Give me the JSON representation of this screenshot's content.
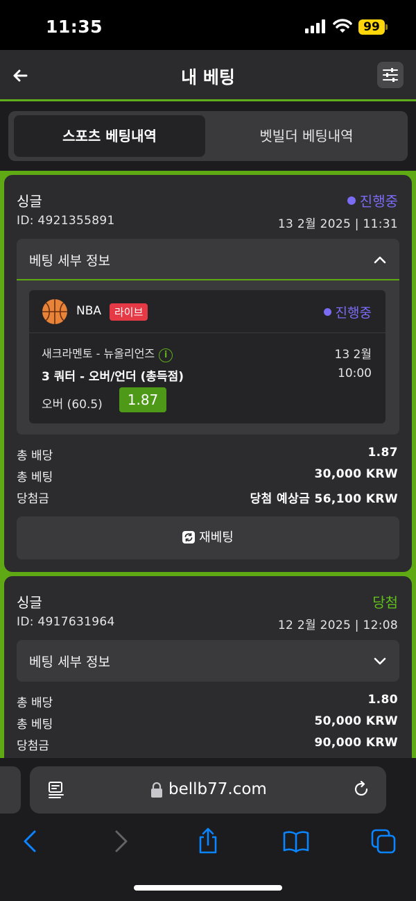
{
  "status_bar": {
    "time": "11:35",
    "battery": "99"
  },
  "header": {
    "title": "내 베팅"
  },
  "tabs": [
    {
      "label": "스포츠 베팅내역",
      "active": true
    },
    {
      "label": "벳빌더 베팅내역",
      "active": false
    }
  ],
  "bets": [
    {
      "type": "싱글",
      "status": "진행중",
      "id": "ID: 4921355891",
      "date": "13 2월 2025 | 11:31",
      "details_label": "베팅 세부 정보",
      "selection": {
        "league": "NBA",
        "live_badge": "라이브",
        "status": "진행중",
        "match": "새크라멘토 - 뉴올리언즈",
        "match_date": "13 2월",
        "market": "3 쿼터 - 오버/언더 (총득점)",
        "match_time": "10:00",
        "pick": "오버 (60.5)",
        "odds": "1.87"
      },
      "summary": [
        {
          "label": "총 배당",
          "value": "1.87"
        },
        {
          "label": "총 베팅",
          "value": "30,000 KRW"
        },
        {
          "label": "당첨금",
          "value": "당첨 예상금 56,100 KRW"
        }
      ],
      "rebet_label": "재베팅"
    },
    {
      "type": "싱글",
      "status": "당첨",
      "id": "ID: 4917631964",
      "date": "12 2월 2025 | 12:08",
      "details_label": "베팅 세부 정보",
      "summary": [
        {
          "label": "총 배당",
          "value": "1.80"
        },
        {
          "label": "총 베팅",
          "value": "50,000 KRW"
        },
        {
          "label": "당첨금",
          "value": "90,000 KRW"
        }
      ]
    }
  ],
  "browser": {
    "url": "bellb77.com"
  },
  "colors": {
    "accent_green": "#5ea914",
    "live_red": "#e63946",
    "in_progress_purple": "#7b6cf6"
  }
}
